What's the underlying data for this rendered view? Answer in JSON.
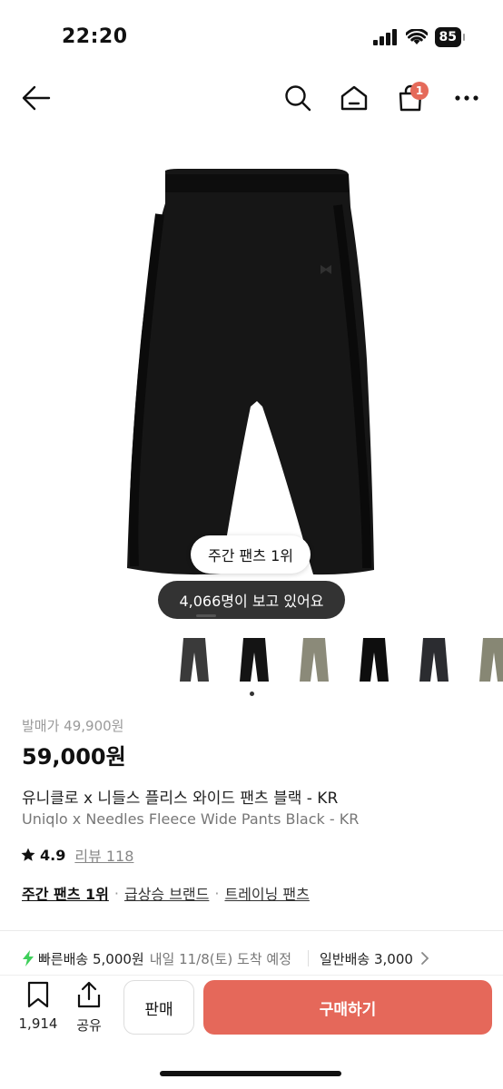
{
  "status": {
    "time": "22:20",
    "battery": "85"
  },
  "nav": {
    "cart_count": "1"
  },
  "hero": {
    "rank_badge": "주간 팬츠 1위",
    "viewers": "4,066명이 보고 있어요"
  },
  "thumbnails": [
    {
      "color": "#3a3a3a"
    },
    {
      "color": "#141414"
    },
    {
      "color": "#8b8a79"
    },
    {
      "color": "#0e0e0e"
    },
    {
      "color": "#2b2c30"
    },
    {
      "color": "#878774"
    }
  ],
  "product": {
    "release_price": "발매가 49,900원",
    "price": "59,000원",
    "name_ko": "유니클로 x 니들스 플리스 와이드 팬츠 블랙 - KR",
    "name_en": "Uniqlo x Needles Fleece Wide Pants Black - KR",
    "rating": "4.9",
    "review_label": "리뷰 118",
    "tags": [
      "주간 팬츠 1위",
      "급상승 브랜드",
      "트레이닝 팬츠"
    ],
    "tag_separator": "·"
  },
  "shipping": {
    "fast_label": "빠른배송 5,000원",
    "fast_date": "내일 11/8(토) 도착 예정",
    "normal_label": "일반배송 3,000"
  },
  "bottom_bar": {
    "saved_count": "1,914",
    "share_label": "공유",
    "sell_label": "판매",
    "buy_label": "구매하기"
  },
  "colors": {
    "accent": "#e5685a",
    "badge": "#e56a5a",
    "bolt": "#3ecf5a"
  }
}
